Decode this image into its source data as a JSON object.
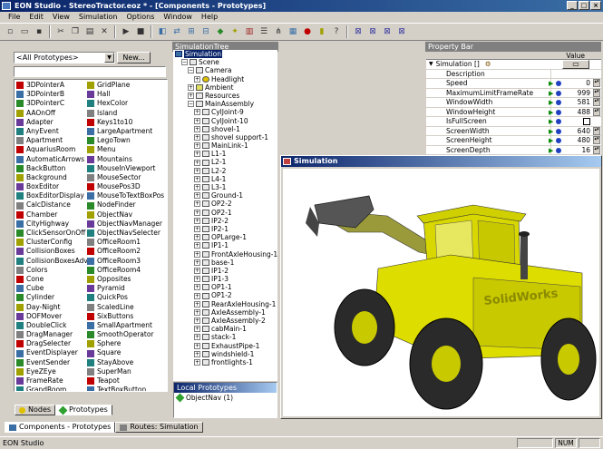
{
  "window": {
    "title": "EON Studio - StereoTractor.eoz * - [Components - Prototypes]"
  },
  "menu": [
    "File",
    "Edit",
    "View",
    "Simulation",
    "Options",
    "Window",
    "Help"
  ],
  "components": {
    "filter_value": "<All Prototypes>",
    "new_button": "New...",
    "col1": [
      "3DPointerA",
      "3DPointerB",
      "3DPointerC",
      "AAOnOff",
      "Adapter",
      "AnyEvent",
      "Apartment",
      "AquariusRoom",
      "AutomaticArrows",
      "BackButton",
      "Background",
      "BoxEditor",
      "BoxEditorDisplay",
      "CalcDistance",
      "Chamber",
      "CityHighway",
      "ClickSensorOnOff",
      "ClusterConfig",
      "CollisionBoxes",
      "CollisionBoxesAdv",
      "Colors",
      "Cone",
      "Cube",
      "Cylinder",
      "Day-Night",
      "DOFMover",
      "DoubleClick",
      "DragManager",
      "DragSelecter",
      "EventDisplayer",
      "EventSender",
      "EyeZEye",
      "FrameRate",
      "GrandRoom"
    ],
    "col2": [
      "GridPlane",
      "Hall",
      "HexColor",
      "Island",
      "Keys1to10",
      "LargeApartment",
      "LegoTown",
      "Menu",
      "Mountains",
      "MouseInViewport",
      "MouseSector",
      "MousePos3D",
      "MouseToTextBoxPos",
      "NodeFinder",
      "ObjectNav",
      "ObjectNavManager",
      "ObjectNavSelecter",
      "OfficeRoom1",
      "OfficeRoom2",
      "OfficeRoom3",
      "OfficeRoom4",
      "Opposites",
      "Pyramid",
      "QuickPos",
      "ScaledLine",
      "SixButtons",
      "SmallApartment",
      "SmoothOperator",
      "Sphere",
      "Square",
      "StayAbove",
      "SuperMan",
      "Teapot",
      "TextBoxButton"
    ],
    "tabs": [
      "Nodes",
      "Prototypes"
    ],
    "bottom_tabs": [
      "Components - Prototypes",
      "Routes: Simulation"
    ]
  },
  "simtree": {
    "title": "SimulationTree",
    "items": [
      {
        "label": "Simulation",
        "indent": 0
      },
      {
        "label": "Scene",
        "indent": 1
      },
      {
        "label": "Camera",
        "indent": 2
      },
      {
        "label": "Headlight",
        "indent": 3
      },
      {
        "label": "Ambient",
        "indent": 2
      },
      {
        "label": "Resources",
        "indent": 2
      },
      {
        "label": "MainAssembly",
        "indent": 2
      },
      {
        "label": "CylJoint-9",
        "indent": 3
      },
      {
        "label": "CylJoint-10",
        "indent": 3
      },
      {
        "label": "shovel-1",
        "indent": 3
      },
      {
        "label": "shovel support-1",
        "indent": 3
      },
      {
        "label": "MainLink-1",
        "indent": 3
      },
      {
        "label": "L1-1",
        "indent": 3
      },
      {
        "label": "L2-1",
        "indent": 3
      },
      {
        "label": "L2-2",
        "indent": 3
      },
      {
        "label": "L4-1",
        "indent": 3
      },
      {
        "label": "L3-1",
        "indent": 3
      },
      {
        "label": "Ground-1",
        "indent": 3
      },
      {
        "label": "OP2-2",
        "indent": 3
      },
      {
        "label": "OP2-1",
        "indent": 3
      },
      {
        "label": "IP2-2",
        "indent": 3
      },
      {
        "label": "IP2-1",
        "indent": 3
      },
      {
        "label": "OPLarge-1",
        "indent": 3
      },
      {
        "label": "IP1-1",
        "indent": 3
      },
      {
        "label": "FrontAxleHousing-1",
        "indent": 3
      },
      {
        "label": "base-1",
        "indent": 3
      },
      {
        "label": "IP1-2",
        "indent": 3
      },
      {
        "label": "IP1-3",
        "indent": 3
      },
      {
        "label": "OP1-1",
        "indent": 3
      },
      {
        "label": "OP1-2",
        "indent": 3
      },
      {
        "label": "RearAxleHousing-1",
        "indent": 3
      },
      {
        "label": "AxleAssembly-1",
        "indent": 3
      },
      {
        "label": "AxleAssembly-2",
        "indent": 3
      },
      {
        "label": "cabMain-1",
        "indent": 3
      },
      {
        "label": "stack-1",
        "indent": 3
      },
      {
        "label": "ExhaustPipe-1",
        "indent": 3
      },
      {
        "label": "windshield-1",
        "indent": 3
      },
      {
        "label": "frontlights-1",
        "indent": 3
      }
    ],
    "local_title": "Local Prototypes",
    "local_item": "ObjectNav (1)"
  },
  "propertybar": {
    "title": "Property Bar",
    "value_header": "Value",
    "node": "Simulation []",
    "rows": [
      {
        "label": "Description",
        "value": "",
        "arrow": false
      },
      {
        "label": "Speed",
        "value": "0",
        "arrow": true
      },
      {
        "label": "MaximumLimitFrameRate",
        "value": "999",
        "arrow": true
      },
      {
        "label": "WindowWidth",
        "value": "581",
        "arrow": true
      },
      {
        "label": "WindowHeight",
        "value": "488",
        "arrow": true
      },
      {
        "label": "IsFullScreen",
        "value": "",
        "arrow": true
      },
      {
        "label": "ScreenWidth",
        "value": "640",
        "arrow": true
      },
      {
        "label": "ScreenHeight",
        "value": "480",
        "arrow": true
      },
      {
        "label": "ScreenDepth",
        "value": "16",
        "arrow": true
      }
    ]
  },
  "simulation": {
    "title": "Simulation",
    "logo_text": "SolidWorks"
  },
  "status": {
    "left": "EON Studio",
    "num": "NUM"
  }
}
